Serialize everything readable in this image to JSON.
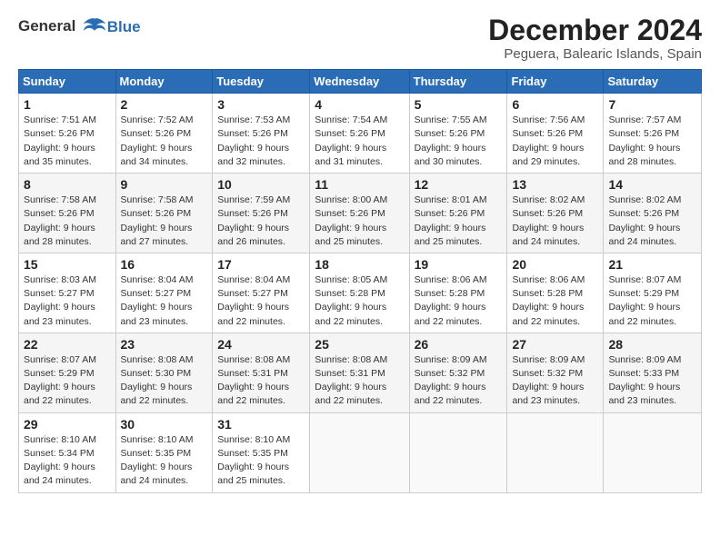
{
  "title": "December 2024",
  "subtitle": "Peguera, Balearic Islands, Spain",
  "logo": {
    "line1": "General",
    "line2": "Blue"
  },
  "weekdays": [
    "Sunday",
    "Monday",
    "Tuesday",
    "Wednesday",
    "Thursday",
    "Friday",
    "Saturday"
  ],
  "weeks": [
    [
      {
        "day": "1",
        "sunrise": "7:51 AM",
        "sunset": "5:26 PM",
        "daylight": "9 hours and 35 minutes."
      },
      {
        "day": "2",
        "sunrise": "7:52 AM",
        "sunset": "5:26 PM",
        "daylight": "9 hours and 34 minutes."
      },
      {
        "day": "3",
        "sunrise": "7:53 AM",
        "sunset": "5:26 PM",
        "daylight": "9 hours and 32 minutes."
      },
      {
        "day": "4",
        "sunrise": "7:54 AM",
        "sunset": "5:26 PM",
        "daylight": "9 hours and 31 minutes."
      },
      {
        "day": "5",
        "sunrise": "7:55 AM",
        "sunset": "5:26 PM",
        "daylight": "9 hours and 30 minutes."
      },
      {
        "day": "6",
        "sunrise": "7:56 AM",
        "sunset": "5:26 PM",
        "daylight": "9 hours and 29 minutes."
      },
      {
        "day": "7",
        "sunrise": "7:57 AM",
        "sunset": "5:26 PM",
        "daylight": "9 hours and 28 minutes."
      }
    ],
    [
      {
        "day": "8",
        "sunrise": "7:58 AM",
        "sunset": "5:26 PM",
        "daylight": "9 hours and 28 minutes."
      },
      {
        "day": "9",
        "sunrise": "7:58 AM",
        "sunset": "5:26 PM",
        "daylight": "9 hours and 27 minutes."
      },
      {
        "day": "10",
        "sunrise": "7:59 AM",
        "sunset": "5:26 PM",
        "daylight": "9 hours and 26 minutes."
      },
      {
        "day": "11",
        "sunrise": "8:00 AM",
        "sunset": "5:26 PM",
        "daylight": "9 hours and 25 minutes."
      },
      {
        "day": "12",
        "sunrise": "8:01 AM",
        "sunset": "5:26 PM",
        "daylight": "9 hours and 25 minutes."
      },
      {
        "day": "13",
        "sunrise": "8:02 AM",
        "sunset": "5:26 PM",
        "daylight": "9 hours and 24 minutes."
      },
      {
        "day": "14",
        "sunrise": "8:02 AM",
        "sunset": "5:26 PM",
        "daylight": "9 hours and 24 minutes."
      }
    ],
    [
      {
        "day": "15",
        "sunrise": "8:03 AM",
        "sunset": "5:27 PM",
        "daylight": "9 hours and 23 minutes."
      },
      {
        "day": "16",
        "sunrise": "8:04 AM",
        "sunset": "5:27 PM",
        "daylight": "9 hours and 23 minutes."
      },
      {
        "day": "17",
        "sunrise": "8:04 AM",
        "sunset": "5:27 PM",
        "daylight": "9 hours and 22 minutes."
      },
      {
        "day": "18",
        "sunrise": "8:05 AM",
        "sunset": "5:28 PM",
        "daylight": "9 hours and 22 minutes."
      },
      {
        "day": "19",
        "sunrise": "8:06 AM",
        "sunset": "5:28 PM",
        "daylight": "9 hours and 22 minutes."
      },
      {
        "day": "20",
        "sunrise": "8:06 AM",
        "sunset": "5:28 PM",
        "daylight": "9 hours and 22 minutes."
      },
      {
        "day": "21",
        "sunrise": "8:07 AM",
        "sunset": "5:29 PM",
        "daylight": "9 hours and 22 minutes."
      }
    ],
    [
      {
        "day": "22",
        "sunrise": "8:07 AM",
        "sunset": "5:29 PM",
        "daylight": "9 hours and 22 minutes."
      },
      {
        "day": "23",
        "sunrise": "8:08 AM",
        "sunset": "5:30 PM",
        "daylight": "9 hours and 22 minutes."
      },
      {
        "day": "24",
        "sunrise": "8:08 AM",
        "sunset": "5:31 PM",
        "daylight": "9 hours and 22 minutes."
      },
      {
        "day": "25",
        "sunrise": "8:08 AM",
        "sunset": "5:31 PM",
        "daylight": "9 hours and 22 minutes."
      },
      {
        "day": "26",
        "sunrise": "8:09 AM",
        "sunset": "5:32 PM",
        "daylight": "9 hours and 22 minutes."
      },
      {
        "day": "27",
        "sunrise": "8:09 AM",
        "sunset": "5:32 PM",
        "daylight": "9 hours and 23 minutes."
      },
      {
        "day": "28",
        "sunrise": "8:09 AM",
        "sunset": "5:33 PM",
        "daylight": "9 hours and 23 minutes."
      }
    ],
    [
      {
        "day": "29",
        "sunrise": "8:10 AM",
        "sunset": "5:34 PM",
        "daylight": "9 hours and 24 minutes."
      },
      {
        "day": "30",
        "sunrise": "8:10 AM",
        "sunset": "5:35 PM",
        "daylight": "9 hours and 24 minutes."
      },
      {
        "day": "31",
        "sunrise": "8:10 AM",
        "sunset": "5:35 PM",
        "daylight": "9 hours and 25 minutes."
      },
      null,
      null,
      null,
      null
    ]
  ]
}
